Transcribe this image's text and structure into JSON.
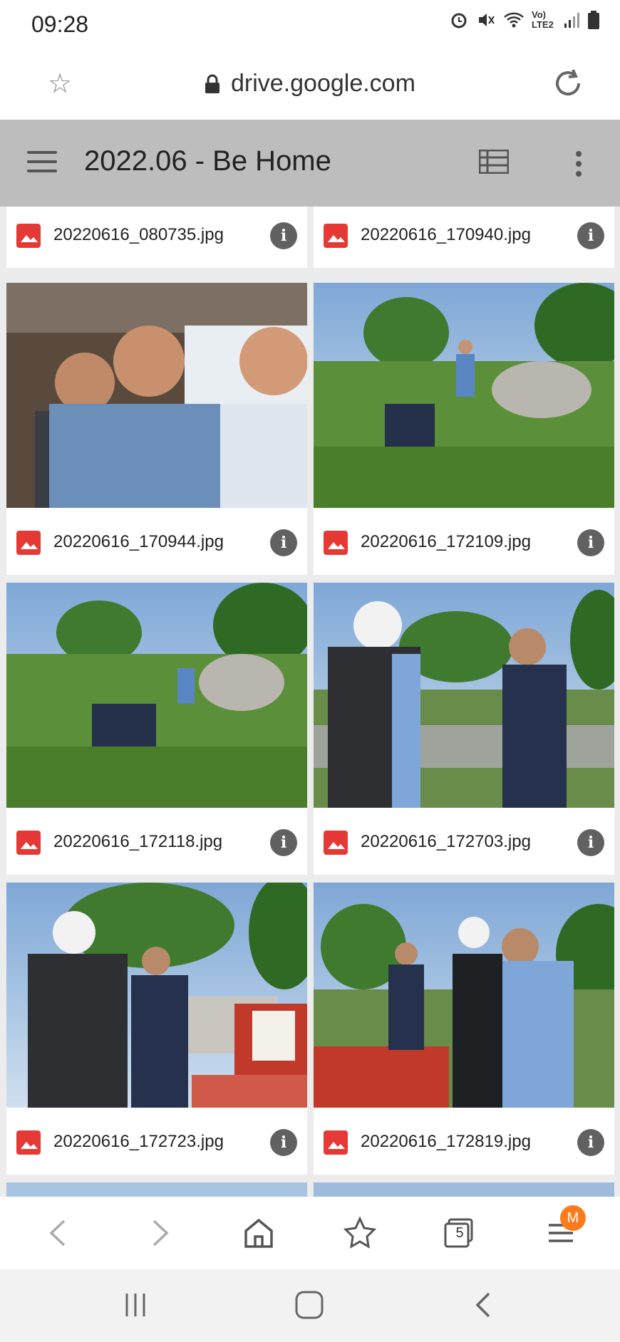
{
  "status_bar": {
    "time": "09:28",
    "network": "Vo) LTE2"
  },
  "browser": {
    "url": "drive.google.com"
  },
  "header": {
    "title": "2022.06 - Be Home"
  },
  "files": [
    {
      "name": "20220616_080735.jpg"
    },
    {
      "name": "20220616_170940.jpg"
    },
    {
      "name": "20220616_170944.jpg"
    },
    {
      "name": "20220616_172109.jpg"
    },
    {
      "name": "20220616_172118.jpg"
    },
    {
      "name": "20220616_172703.jpg"
    },
    {
      "name": "20220616_172723.jpg"
    },
    {
      "name": "20220616_172819.jpg"
    }
  ],
  "bottom_nav": {
    "tabs_count": "5",
    "profile_badge": "M"
  },
  "colors": {
    "file_icon": "#e53935",
    "header_bg": "#bdbdbd",
    "badge": "#ff7a1a"
  }
}
